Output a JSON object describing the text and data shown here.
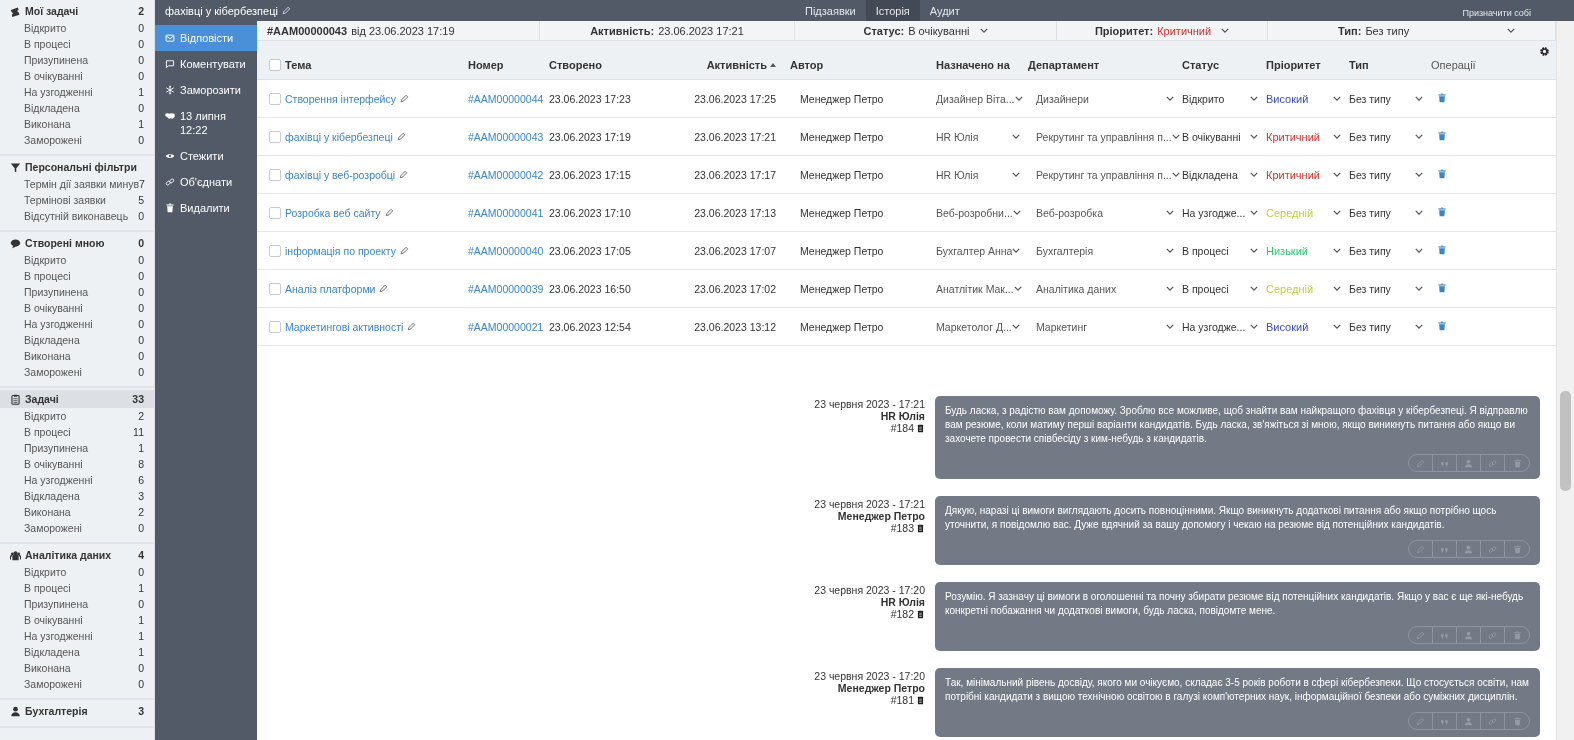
{
  "sidebar": {
    "groups": [
      {
        "title": "Мої задачі",
        "count": "2",
        "selected": false,
        "items": [
          {
            "label": "Відкрито",
            "count": "0"
          },
          {
            "label": "В процесі",
            "count": "0"
          },
          {
            "label": "Призупинена",
            "count": "0"
          },
          {
            "label": "В очікуванні",
            "count": "0"
          },
          {
            "label": "На узгодженні",
            "count": "1"
          },
          {
            "label": "Відкладена",
            "count": "0"
          },
          {
            "label": "Виконана",
            "count": "1"
          },
          {
            "label": "Заморожені",
            "count": "0"
          }
        ]
      },
      {
        "title": "Персональні фільтри",
        "selected": false,
        "items": [
          {
            "label": "Термін дії заявки минув",
            "count": "7"
          },
          {
            "label": "Термінові заявки",
            "count": "5"
          },
          {
            "label": "Відсутній виконавець",
            "count": "0"
          }
        ]
      },
      {
        "title": "Створені мною",
        "count": "0",
        "selected": false,
        "items": [
          {
            "label": "Відкрито",
            "count": "0"
          },
          {
            "label": "В процесі",
            "count": "0"
          },
          {
            "label": "Призупинена",
            "count": "0"
          },
          {
            "label": "В очікуванні",
            "count": "0"
          },
          {
            "label": "На узгодженні",
            "count": "0"
          },
          {
            "label": "Відкладена",
            "count": "0"
          },
          {
            "label": "Виконана",
            "count": "0"
          },
          {
            "label": "Заморожені",
            "count": "0"
          }
        ]
      },
      {
        "title": "Задачі",
        "count": "33",
        "selected": true,
        "items": [
          {
            "label": "Відкрито",
            "count": "2"
          },
          {
            "label": "В процесі",
            "count": "11"
          },
          {
            "label": "Призупинена",
            "count": "1"
          },
          {
            "label": "В очікуванні",
            "count": "8"
          },
          {
            "label": "На узгодженні",
            "count": "6"
          },
          {
            "label": "Відкладена",
            "count": "3"
          },
          {
            "label": "Виконана",
            "count": "2"
          },
          {
            "label": "Заморожені",
            "count": "0"
          }
        ]
      },
      {
        "title": "Аналітика даних",
        "count": "4",
        "selected": false,
        "items": [
          {
            "label": "Відкрито",
            "count": "0"
          },
          {
            "label": "В процесі",
            "count": "1"
          },
          {
            "label": "Призупинена",
            "count": "0"
          },
          {
            "label": "В очікуванні",
            "count": "1"
          },
          {
            "label": "На узгодженні",
            "count": "1"
          },
          {
            "label": "Відкладена",
            "count": "1"
          },
          {
            "label": "Виконана",
            "count": "0"
          },
          {
            "label": "Заморожені",
            "count": "0"
          }
        ]
      },
      {
        "title": "Бухгалтерія",
        "count": "3",
        "selected": false
      }
    ]
  },
  "topbar": {
    "title": "фахівці у кібербезпеці",
    "tabs": [
      {
        "label": "Підзаявки",
        "selected": false
      },
      {
        "label": "Історія",
        "selected": true
      },
      {
        "label": "Аудит",
        "selected": false
      }
    ],
    "assign_button": "Призначити собі"
  },
  "actions": [
    {
      "label": "Відповісти",
      "selected": true
    },
    {
      "label": "Коментувати",
      "selected": false
    },
    {
      "label": "Заморозити",
      "selected": false
    },
    {
      "label": "13 липня 12:22",
      "selected": false
    },
    {
      "label": "Стежити",
      "selected": false
    },
    {
      "label": "Об'єднати",
      "selected": false
    },
    {
      "label": "Видалити",
      "selected": false
    }
  ],
  "infobar": {
    "number": "#AAM00000043",
    "created": "від 23.06.2023 17:19",
    "activity_label": "Активність:",
    "activity": "23.06.2023 17:21",
    "status_label": "Статус:",
    "status": "В очікуванні",
    "priority_label": "Пріоритет:",
    "priority": {
      "label": "Критичний",
      "color": "#d0312d"
    },
    "type_label": "Тип:",
    "type": "Без типу"
  },
  "table": {
    "all_checked": false,
    "columns": [
      "Тема",
      "Номер",
      "Створено",
      "Активність",
      "Автор",
      "Назначено на",
      "Департамент",
      "Статус",
      "Пріоритет",
      "Тип",
      "Операції"
    ],
    "rows": [
      {
        "checked": false,
        "subject": "Створення інтерфейсу",
        "number": "#AAM00000044",
        "created": "23.06.2023 17:23",
        "activity": "23.06.2023 17:25",
        "author": "Менеджер Петро",
        "assignee": "Дизайнер Віта...",
        "department": "Дизайнери",
        "status": "Відкрито",
        "priority": {
          "label": "Високий",
          "color": "#3b4fb8"
        },
        "type": "Без типу"
      },
      {
        "checked": false,
        "subject": "фахівці у кібербезпеці",
        "number": "#AAM00000043",
        "created": "23.06.2023 17:19",
        "activity": "23.06.2023 17:21",
        "author": "Менеджер Петро",
        "assignee": "HR Юлія",
        "department": "Рекрутинг та управління п...",
        "status": "В очікуванні",
        "priority": {
          "label": "Критичний",
          "color": "#d0312d"
        },
        "type": "Без типу"
      },
      {
        "checked": false,
        "subject": "фахівці у веб-розробці",
        "number": "#AAM00000042",
        "created": "23.06.2023 17:15",
        "activity": "23.06.2023 17:17",
        "author": "Менеджер Петро",
        "assignee": "HR Юлія",
        "department": "Рекрутинг та управління п...",
        "status": "Відкладена",
        "priority": {
          "label": "Критичний",
          "color": "#d0312d"
        },
        "type": "Без типу"
      },
      {
        "checked": false,
        "subject": "Розробка веб сайту",
        "number": "#AAM00000041",
        "created": "23.06.2023 17:10",
        "activity": "23.06.2023 17:13",
        "author": "Менеджер Петро",
        "assignee": "Веб-розробни...",
        "department": "Веб-розробка",
        "status": "На узгодже...",
        "priority": {
          "label": "Середній",
          "color": "#c2cf3a"
        },
        "type": "Без типу"
      },
      {
        "checked": false,
        "subject": "інформація по проекту",
        "number": "#AAM00000040",
        "created": "23.06.2023 17:05",
        "activity": "23.06.2023 17:07",
        "author": "Менеджер Петро",
        "assignee": "Бухгалтер Анна",
        "department": "Бухгалтерія",
        "status": "В процесі",
        "priority": {
          "label": "Низький",
          "color": "#2ecc71"
        },
        "type": "Без типу"
      },
      {
        "checked": false,
        "subject": "Аналіз платформи",
        "number": "#AAM00000039",
        "created": "23.06.2023 16:50",
        "activity": "23.06.2023 17:02",
        "author": "Менеджер Петро",
        "assignee": "Анатлітик Мак...",
        "department": "Аналітика даних",
        "status": "В процесі",
        "priority": {
          "label": "Середній",
          "color": "#c2cf3a"
        },
        "type": "Без типу"
      },
      {
        "checked": false,
        "subject": "Маркетингові активності",
        "number": "#AAM00000021",
        "created": "23.06.2023 12:54",
        "activity": "23.06.2023 13:12",
        "author": "Менеджер Петро",
        "assignee": "Маркетолог Д...",
        "department": "Маркетинг",
        "status": "На узгодже...",
        "priority": {
          "label": "Високий",
          "color": "#3b4fb8"
        },
        "type": "Без типу"
      }
    ]
  },
  "messages": [
    {
      "date": "23 червня 2023 - 17:21",
      "author": "HR Юлія",
      "number": "#184",
      "text": "Будь ласка, з радістю вам допоможу. Зроблю все можливе, щоб знайти вам найкращого фахівця у кібербезпеці. Я відправлю вам резюме, коли матиму перші варіанти кандидатів. Будь ласка, зв'яжіться зі мною, якщо виникнуть питання або якщо ви захочете провести співбесіду з ким-небудь з кандидатів."
    },
    {
      "date": "23 червня 2023 - 17:21",
      "author": "Менеджер Петро",
      "number": "#183",
      "text": "Дякую, наразі ці вимоги виглядають досить повноцінними. Якщо виникнуть додаткові питання або якщо потрібно щось уточнити, я повідомлю вас. Дуже вдячний за вашу допомогу і чекаю на резюме від потенційних кандидатів."
    },
    {
      "date": "23 червня 2023 - 17:20",
      "author": "HR Юлія",
      "number": "#182",
      "text": "Розумію. Я зазначу ці вимоги в оголошенні та почну збирати резюме від потенційних кандидатів. Якщо у вас є ще які-небудь конкретні побажання чи додаткові вимоги, будь ласка, повідомте мене."
    },
    {
      "date": "23 червня 2023 - 17:20",
      "author": "Менеджер Петро",
      "number": "#181",
      "text": "Так, мінімальний рівень досвіду, якого ми очікуємо, складає 3-5 років роботи в сфері кібербезпеки. Що стосується освіти, нам потрібні кандидати з вищою технічною освітою в галузі комп'ютерних наук, інформаційної безпеки або суміжних дисциплін."
    }
  ]
}
